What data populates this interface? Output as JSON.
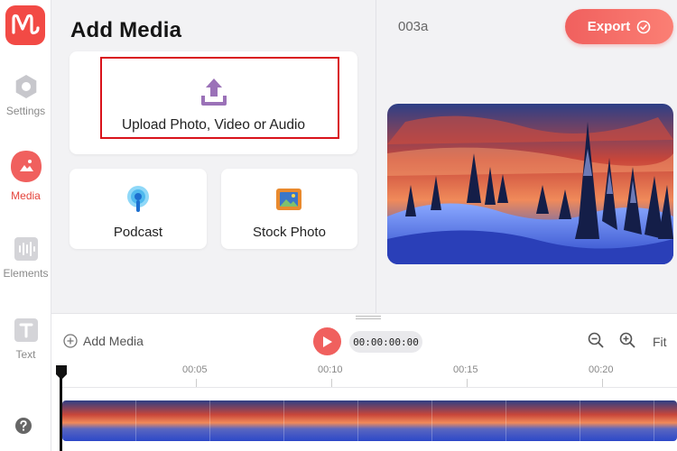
{
  "sidebar": {
    "items": [
      {
        "label": "Settings",
        "icon": "hexagon-settings-icon",
        "active": false
      },
      {
        "label": "Media",
        "icon": "media-icon",
        "active": true
      },
      {
        "label": "Elements",
        "icon": "audio-wave-icon",
        "active": false
      },
      {
        "label": "Text",
        "icon": "text-icon",
        "active": false
      }
    ],
    "help_icon": "help-icon"
  },
  "panel": {
    "title": "Add Media",
    "upload_label": "Upload Photo, Video or Audio",
    "podcast_label": "Podcast",
    "stock_photo_label": "Stock Photo"
  },
  "header": {
    "project_name": "003a",
    "export_label": "Export"
  },
  "timeline": {
    "add_media_label": "Add Media",
    "current_time": "00:00:00:00",
    "fit_label": "Fit",
    "ruler": [
      "00:05",
      "00:10",
      "00:15",
      "00:20"
    ]
  },
  "colors": {
    "accent": "#f0605e",
    "highlight_border": "#d9131b",
    "upload_icon": "#9b72b8"
  }
}
